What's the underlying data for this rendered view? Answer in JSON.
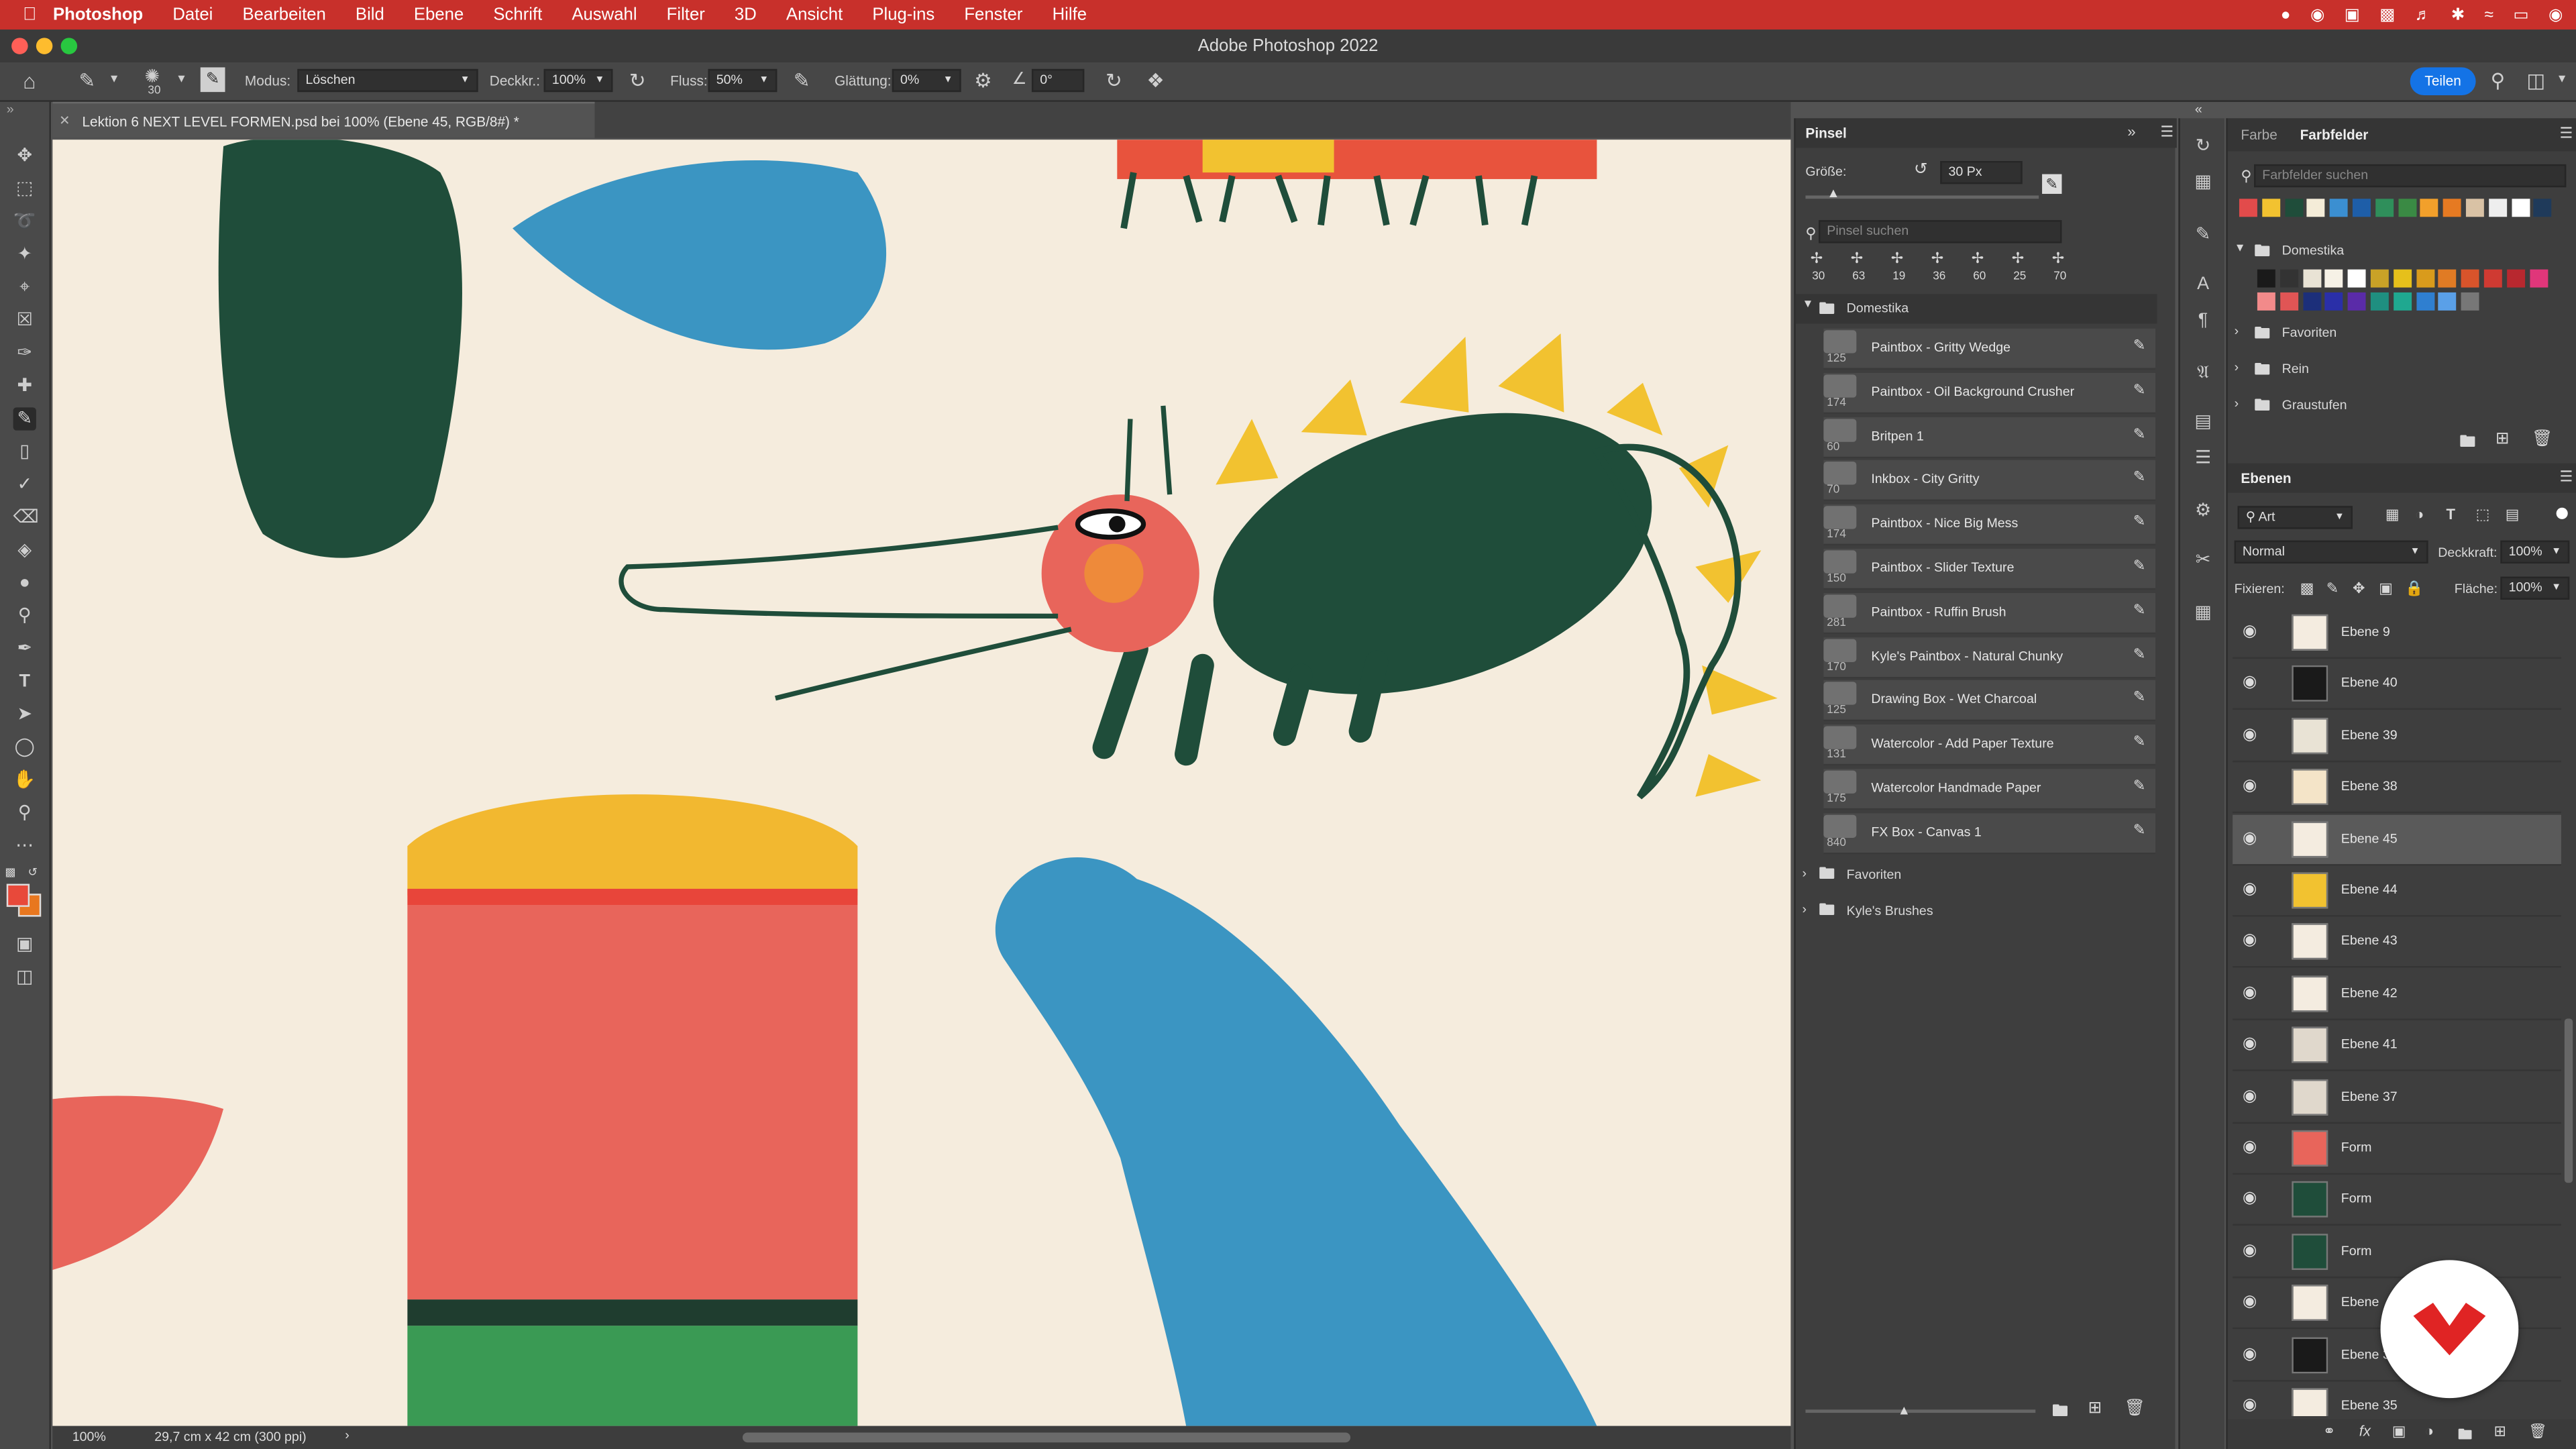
{
  "menubar": {
    "items": [
      "Photoshop",
      "Datei",
      "Bearbeiten",
      "Bild",
      "Ebene",
      "Schrift",
      "Auswahl",
      "Filter",
      "3D",
      "Ansicht",
      "Plug-ins",
      "Fenster",
      "Hilfe"
    ],
    "apple_icon": "apple-icon",
    "accent": "#c8302b"
  },
  "window": {
    "title": "Adobe Photoshop 2022"
  },
  "options": {
    "mode_label": "Modus:",
    "mode_value": "Löschen",
    "opacity_label": "Deckkr.:",
    "opacity_value": "100%",
    "flow_label": "Fluss:",
    "flow_value": "50%",
    "smoothing_label": "Glättung:",
    "smoothing_value": "0%",
    "angle_value": "0°",
    "brush_size": "30",
    "share_label": "Teilen"
  },
  "document": {
    "tab_title": "Lektion 6 NEXT LEVEL FORMEN.psd bei 100% (Ebene 45, RGB/8#) *",
    "zoom": "100%",
    "doc_info": "29,7 cm x 42 cm (300 ppi)"
  },
  "brush_panel": {
    "tab": "Pinsel",
    "size_label": "Größe:",
    "size_value": "30 Px",
    "search_placeholder": "Pinsel suchen",
    "recent_sizes": [
      "30",
      "63",
      "19",
      "36",
      "60",
      "25",
      "70"
    ],
    "folder": "Domestika",
    "brushes": [
      {
        "size": "125",
        "name": "Paintbox - Gritty Wedge"
      },
      {
        "size": "174",
        "name": "Paintbox - Oil Background Crusher"
      },
      {
        "size": "60",
        "name": "Britpen 1"
      },
      {
        "size": "70",
        "name": "Inkbox - City Gritty"
      },
      {
        "size": "174",
        "name": "Paintbox - Nice Big Mess"
      },
      {
        "size": "150",
        "name": "Paintbox - Slider Texture"
      },
      {
        "size": "281",
        "name": "Paintbox - Ruffin Brush"
      },
      {
        "size": "170",
        "name": "Kyle's Paintbox - Natural Chunky"
      },
      {
        "size": "125",
        "name": "Drawing Box - Wet Charcoal"
      },
      {
        "size": "131",
        "name": "Watercolor - Add Paper Texture"
      },
      {
        "size": "175",
        "name": "Watercolor Handmade Paper"
      },
      {
        "size": "840",
        "name": "FX Box - Canvas 1"
      }
    ],
    "folders_after": [
      "Favoriten",
      "Kyle's Brushes"
    ]
  },
  "swatches_panel": {
    "tabs": [
      "Farbe",
      "Farbfelder"
    ],
    "search_placeholder": "Farbfelder suchen",
    "recent": [
      "#e24b4b",
      "#f2c230",
      "#1f4d3a",
      "#f4ecd8",
      "#3b8fd1",
      "#1e5ea8",
      "#2f8f5b",
      "#3a8a44",
      "#f2a02b",
      "#e67a22",
      "#d9c2a5",
      "#eeeeee",
      "#ffffff",
      "#1f3a5a"
    ],
    "groups": [
      "Domestika",
      "Favoriten",
      "Rein",
      "Graustufen"
    ],
    "domestika_row1": [
      "#1a1a1a",
      "#333333",
      "#e9e3d5",
      "#f6f1e6",
      "#ffffff",
      "#c9a227",
      "#e6c01b",
      "#d99b1c",
      "#e07b24",
      "#d9542b",
      "#cf3a32",
      "#b8282f",
      "#e0367a"
    ],
    "domestika_row2": [
      "#f28a8a",
      "#e05555",
      "#1c2f7a",
      "#2a2fa8",
      "#5a2ba8",
      "#1f8f80",
      "#1fa890",
      "#2f7fd0",
      "#5aa0e8",
      "#777777"
    ]
  },
  "layers_panel": {
    "tab": "Ebenen",
    "filter_value": "Art",
    "blend_mode": "Normal",
    "opacity_label": "Deckkraft:",
    "opacity_value": "100%",
    "lock_label": "Fixieren:",
    "fill_label": "Fläche:",
    "fill_value": "100%",
    "layers": [
      {
        "name": "Ebene 9",
        "selected": false
      },
      {
        "name": "Ebene 40",
        "selected": false
      },
      {
        "name": "Ebene 39",
        "selected": false
      },
      {
        "name": "Ebene 38",
        "selected": false
      },
      {
        "name": "Ebene 45",
        "selected": true
      },
      {
        "name": "Ebene 44",
        "selected": false
      },
      {
        "name": "Ebene 43",
        "selected": false
      },
      {
        "name": "Ebene 42",
        "selected": false
      },
      {
        "name": "Ebene 41",
        "selected": false
      },
      {
        "name": "Ebene 37",
        "selected": false
      },
      {
        "name": "Form",
        "selected": false
      },
      {
        "name": "Form",
        "selected": false
      },
      {
        "name": "Form",
        "selected": false
      },
      {
        "name": "Ebene",
        "selected": false
      },
      {
        "name": "Ebene 33",
        "selected": false
      },
      {
        "name": "Ebene 35",
        "selected": false
      }
    ]
  },
  "colors": {
    "foreground": "#e8493a",
    "background": "#e8771f",
    "canvas_bg": "#f5ecdd"
  }
}
